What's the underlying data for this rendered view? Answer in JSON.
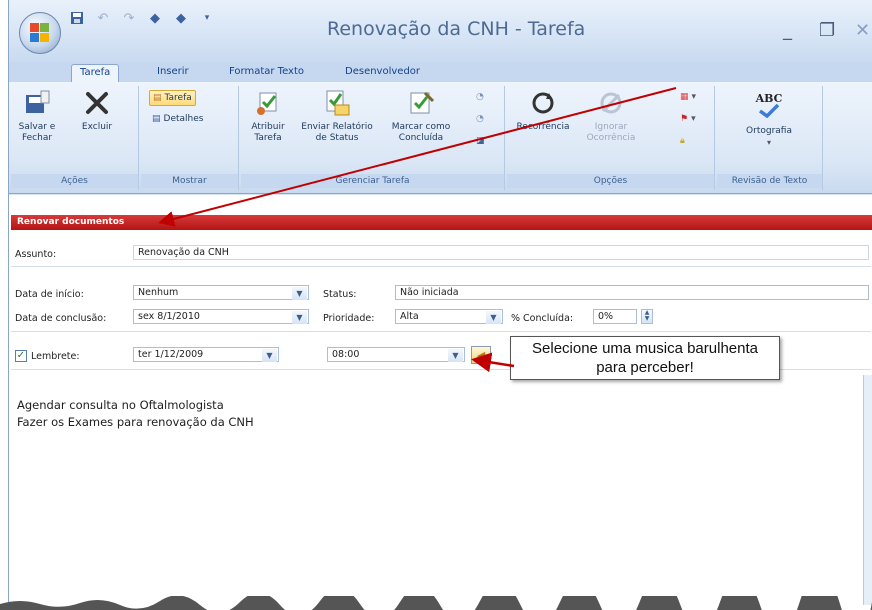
{
  "window": {
    "title": "Renovação da CNH - Tarefa",
    "minimize_glyph": "_",
    "maximize_glyph": "❐",
    "close_glyph": "✕"
  },
  "quick_access": [
    "save-icon",
    "undo-icon",
    "redo-icon",
    "up-icon",
    "down-icon",
    "more-icon"
  ],
  "tabs": [
    {
      "label": "Tarefa",
      "active": true
    },
    {
      "label": "Inserir",
      "active": false
    },
    {
      "label": "Formatar Texto",
      "active": false
    },
    {
      "label": "Desenvolvedor",
      "active": false
    }
  ],
  "ribbon": {
    "acoes": {
      "label": "Ações",
      "save_close": "Salvar e Fechar",
      "delete": "Excluir"
    },
    "mostrar": {
      "label": "Mostrar",
      "tarefa": "Tarefa",
      "detalhes": "Detalhes"
    },
    "gerenciar": {
      "label": "Gerenciar Tarefa",
      "atribuir": "Atribuir Tarefa",
      "enviar": "Enviar Relatório de Status",
      "marcar": "Marcar como Concluída"
    },
    "opcoes": {
      "label": "Opções",
      "recorrencia": "Recorrência",
      "ignorar": "Ignorar Ocorrência"
    },
    "revisao": {
      "label": "Revisão de Texto",
      "ortografia": "Ortografia",
      "abc": "ABC"
    }
  },
  "form": {
    "banner": "Renovar documentos",
    "assunto_label": "Assunto:",
    "assunto_value": "Renovação da CNH",
    "inicio_label": "Data de início:",
    "inicio_value": "Nenhum",
    "status_label": "Status:",
    "status_value": "Não iniciada",
    "conclusao_label": "Data de conclusão:",
    "conclusao_value": "sex 8/1/2010",
    "prioridade_label": "Prioridade:",
    "prioridade_value": "Alta",
    "concluida_label": "% Concluída:",
    "concluida_value": "0%",
    "lembrete_label": "Lembrete:",
    "lembrete_checked": true,
    "lembrete_date": "ter 1/12/2009",
    "lembrete_time": "08:00",
    "body_lines": [
      "Agendar consulta no Oftalmologista",
      "Fazer os Exames para renovação da CNH"
    ]
  },
  "callout": {
    "line1": "Selecione uma musica barulhenta",
    "line2": "para perceber!"
  },
  "colors": {
    "banner": "#c41e1e",
    "arrow": "#c00000",
    "ribbon_text": "#15428b"
  }
}
